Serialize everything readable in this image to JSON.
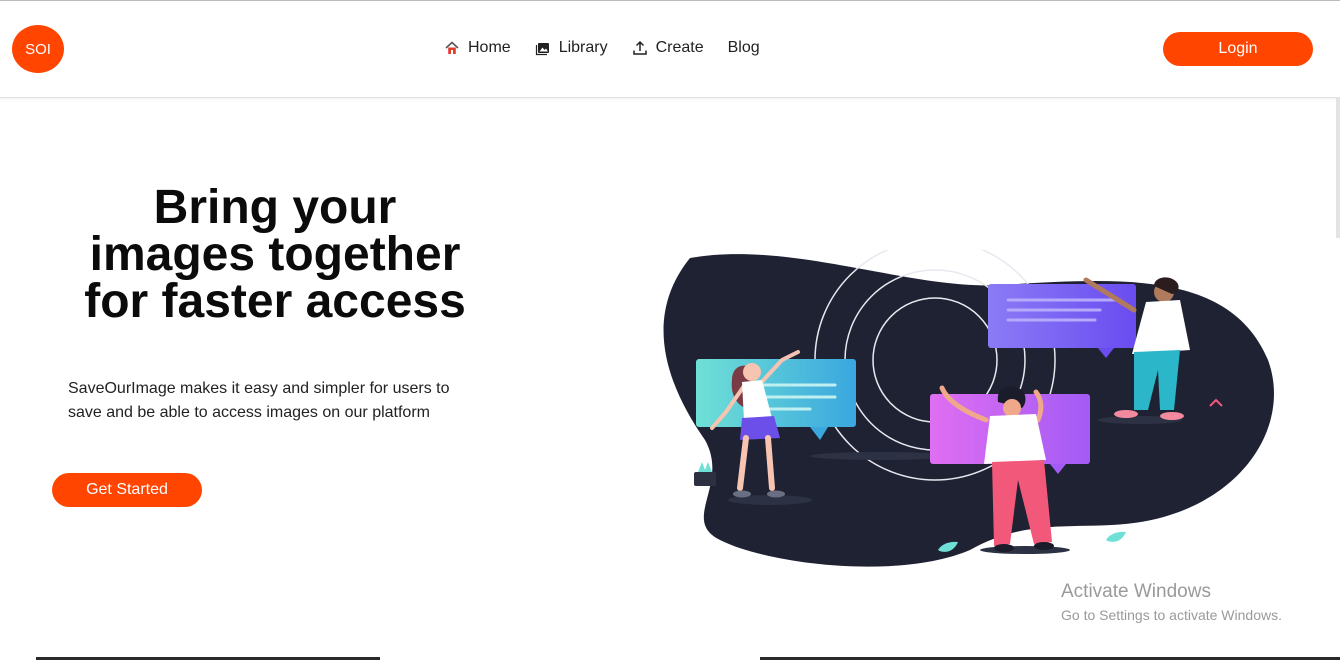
{
  "brand": {
    "logo_text": "SOI",
    "accent_color": "#ff4500"
  },
  "nav": {
    "items": [
      {
        "label": "Home",
        "icon": "home-icon"
      },
      {
        "label": "Library",
        "icon": "image-icon"
      },
      {
        "label": "Create",
        "icon": "upload-icon"
      },
      {
        "label": "Blog",
        "icon": ""
      }
    ],
    "login_label": "Login"
  },
  "hero": {
    "title_lines": [
      "Bring your",
      "images together",
      "for faster access"
    ],
    "description_lines": [
      "SaveOurImage makes it easy and simpler for users to",
      "save and be able to access images on our platform"
    ],
    "cta_label": "Get Started"
  },
  "watermark": {
    "title": "Activate Windows",
    "subtitle": "Go to Settings to activate Windows."
  }
}
